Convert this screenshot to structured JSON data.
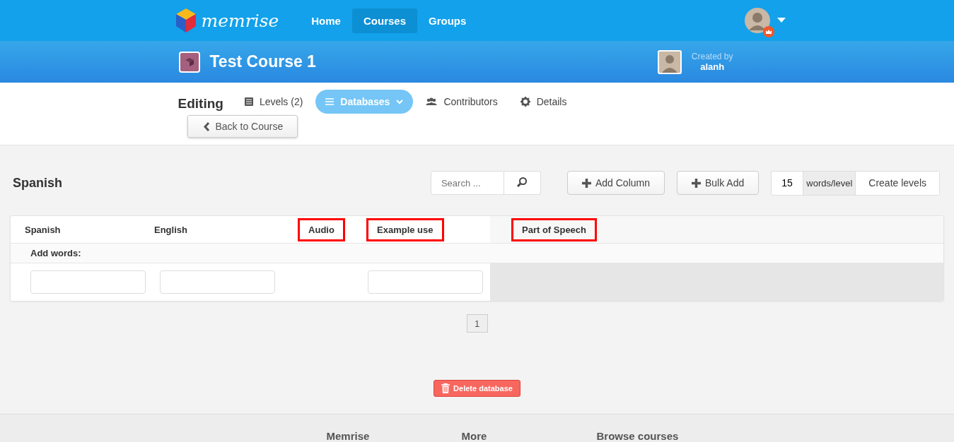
{
  "nav": {
    "logo": "memrise",
    "items": [
      {
        "label": "Home",
        "selected": false
      },
      {
        "label": "Courses",
        "selected": true
      },
      {
        "label": "Groups",
        "selected": false
      }
    ]
  },
  "course": {
    "title": "Test Course 1",
    "created_by_label": "Created by",
    "author": "alanh"
  },
  "editing": {
    "label": "Editing",
    "tabs": [
      {
        "label": "Levels (2)",
        "kind": "levels",
        "selected": false
      },
      {
        "label": "Databases",
        "kind": "databases",
        "selected": true
      },
      {
        "label": "Contributors",
        "kind": "contributors",
        "selected": false
      },
      {
        "label": "Details",
        "kind": "details",
        "selected": false
      }
    ],
    "back_button": "Back to Course"
  },
  "database": {
    "name": "Spanish",
    "search": {
      "placeholder": "Search ..."
    },
    "add_column": "Add Column",
    "bulk_add": "Bulk Add",
    "words_per_level": "15",
    "words_per_level_label": "words/level",
    "create_levels": "Create levels",
    "columns": [
      {
        "label": "Spanish",
        "kind": "text",
        "highlighted": false
      },
      {
        "label": "English",
        "kind": "text",
        "highlighted": false
      },
      {
        "label": "Audio",
        "kind": "audio",
        "highlighted": true
      },
      {
        "label": "Example use",
        "kind": "text",
        "highlighted": true
      },
      {
        "label": "Part of Speech",
        "kind": "attribute",
        "highlighted": true
      }
    ],
    "add_words_label": "Add words:",
    "pages": [
      {
        "label": "1",
        "selected": true
      }
    ],
    "delete_button": "Delete database"
  },
  "footer": {
    "headings": [
      "Memrise",
      "More",
      "Browse courses"
    ]
  }
}
